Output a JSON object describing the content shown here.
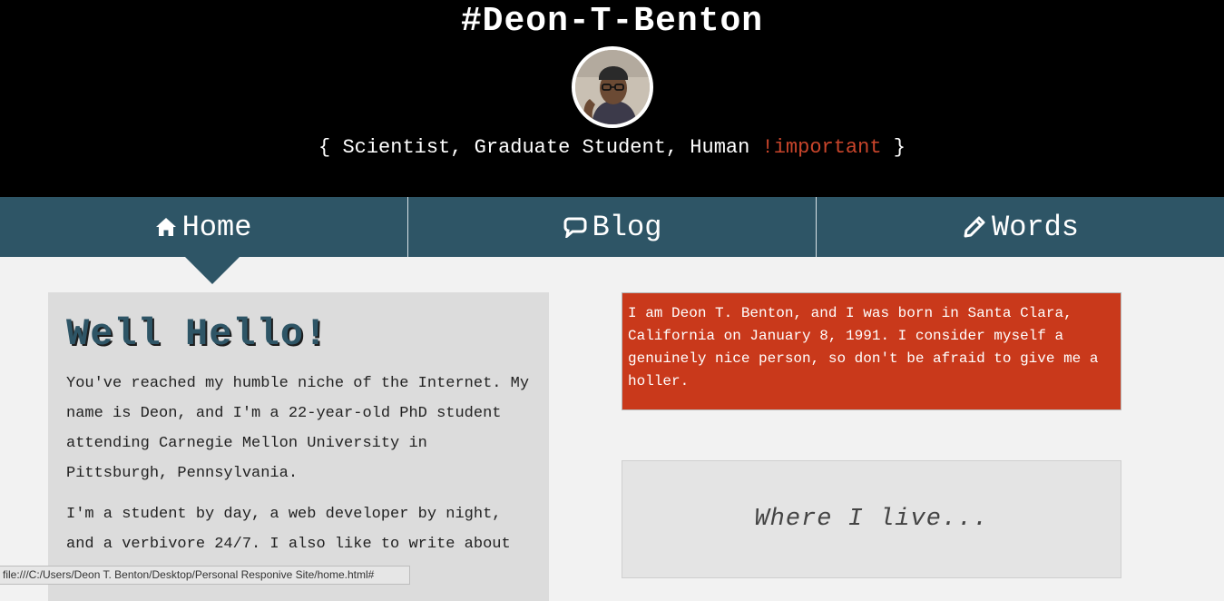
{
  "header": {
    "title": "#Deon-T-Benton",
    "tagline_open": "{ ",
    "tagline_roles": "Scientist, Graduate Student, Human ",
    "tagline_important": "!important",
    "tagline_close": " }",
    "avatar_icon": "profile-photo"
  },
  "nav": {
    "items": [
      {
        "label": "Home",
        "icon": "home-icon"
      },
      {
        "label": "Blog",
        "icon": "speech-bubble-icon"
      },
      {
        "label": "Words",
        "icon": "pencil-icon"
      }
    ],
    "active": "Home"
  },
  "intro": {
    "heading": "Well Hello!",
    "paragraphs": [
      "You've reached my humble niche of the Internet. My name is Deon, and I'm a 22-year-old PhD student attending Carnegie Mellon University in Pittsburgh, Pennsylvania.",
      "I'm a student by day, a web developer by night, and a verbivore 24/7. I also like to write about me"
    ]
  },
  "bio": {
    "text": "I am Deon T. Benton, and I was born in Santa Clara, California on January 8, 1991. I consider myself a genuinely nice person, so don't be afraid to give me a holler."
  },
  "where_i_live": {
    "label": "Where I live..."
  },
  "status_bar": {
    "url": "file:///C:/Users/Deon T. Benton/Desktop/Personal Responive Site/home.html#"
  },
  "colors": {
    "nav": "#2e5566",
    "accent": "#c9391b",
    "header": "#000000"
  }
}
